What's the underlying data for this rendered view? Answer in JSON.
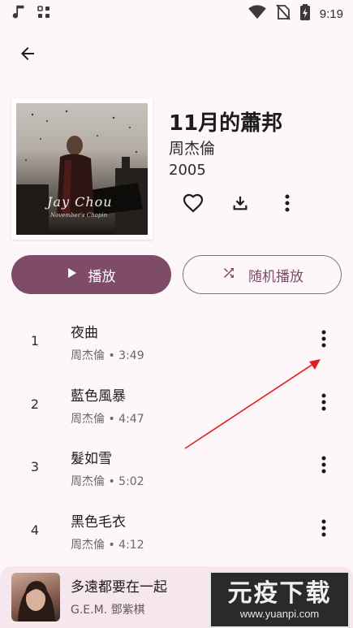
{
  "status_bar": {
    "time": "9:19",
    "left_icons": [
      "music-note-icon",
      "grid-icon"
    ],
    "right_icons": [
      "wifi-icon",
      "no-sim-icon",
      "battery-charging-icon"
    ]
  },
  "header": {
    "back_icon": "arrow-back-icon"
  },
  "album": {
    "cover_text_primary": "Jay Chou",
    "cover_text_secondary": "November's Chopin",
    "title": "11月的蕭邦",
    "artist": "周杰倫",
    "year": "2005",
    "actions": [
      "heart-icon",
      "download-icon",
      "more-vert-icon"
    ]
  },
  "buttons": {
    "play_label": "播放",
    "shuffle_label": "随机播放"
  },
  "tracks": [
    {
      "number": "1",
      "title": "夜曲",
      "subtitle": "周杰倫 • 3:49"
    },
    {
      "number": "2",
      "title": "藍色風暴",
      "subtitle": "周杰倫 • 4:47"
    },
    {
      "number": "3",
      "title": "髮如雪",
      "subtitle": "周杰倫 • 5:02"
    },
    {
      "number": "4",
      "title": "黑色毛衣",
      "subtitle": "周杰倫 • 4:12"
    }
  ],
  "mini_player": {
    "title": "多遠都要在一起",
    "artist": "G.E.M. 鄧紫棋"
  },
  "watermark": {
    "main": "元疫下载",
    "url": "www.yuanpi.com"
  },
  "colors": {
    "accent": "#7e4b68",
    "background": "#fdf7f9",
    "mini_player_bg": "#f6e6ee",
    "annotation_arrow": "#e02020"
  }
}
